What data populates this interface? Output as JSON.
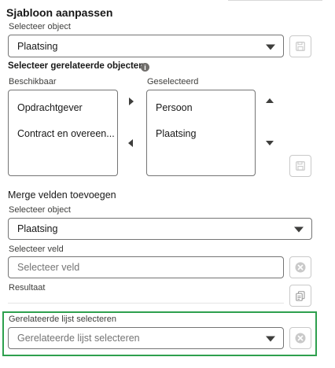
{
  "header": {
    "title": "Sjabloon aanpassen"
  },
  "object_section": {
    "label": "Selecteer object",
    "value": "Plaatsing"
  },
  "related_section": {
    "title": "Selecteer gerelateerde objecten",
    "available_label": "Beschikbaar",
    "selected_label": "Geselecteerd",
    "available": [
      "Opdrachtgever",
      "Contract en overeen..."
    ],
    "selected": [
      "Persoon",
      "Plaatsing"
    ]
  },
  "merge_section": {
    "title": "Merge velden toevoegen",
    "object_label": "Selecteer object",
    "object_value": "Plaatsing",
    "field_label": "Selecteer veld",
    "field_placeholder": "Selecteer veld",
    "result_label": "Resultaat"
  },
  "related_list_section": {
    "label": "Gerelateerde lijst selecteren",
    "placeholder": "Gerelateerde lijst selecteren",
    "highlight_color": "#2ea04e"
  },
  "icons": [
    "save-icon",
    "info-icon",
    "move-right-icon",
    "move-left-icon",
    "move-up-icon",
    "move-down-icon",
    "clear-icon",
    "copy-icon",
    "dropdown-arrow-icon"
  ]
}
